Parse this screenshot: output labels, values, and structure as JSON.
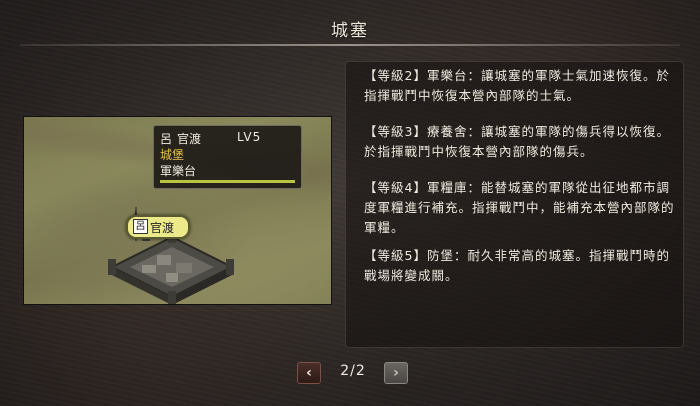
{
  "header": {
    "title": "城塞"
  },
  "preview": {
    "tooltip": {
      "clan_mark": "呂",
      "location": "官渡",
      "level": "LV5",
      "type": "城堡",
      "facility": "軍樂台",
      "bar_level": 1.0
    },
    "badge": {
      "emblem": "呂",
      "name": "官渡"
    }
  },
  "description": {
    "paragraphs": [
      "【等級2】軍樂台：讓城塞的軍隊士氣加速恢復。於指揮戰鬥中恢復本營內部隊的士氣。",
      "【等級3】療養舍：讓城塞的軍隊的傷兵得以恢復。於指揮戰鬥中恢復本營內部隊的傷兵。",
      "【等級4】軍糧庫：能替城塞的軍隊從出征地都市調度軍糧進行補充。指揮戰鬥中，能補充本營內部隊的軍糧。",
      "【等級5】防堡：耐久非常高的城塞。指揮戰鬥時的戰場將變成關。"
    ]
  },
  "pager": {
    "prev_glyph": "‹",
    "next_glyph": "›",
    "page": "2/2"
  }
}
